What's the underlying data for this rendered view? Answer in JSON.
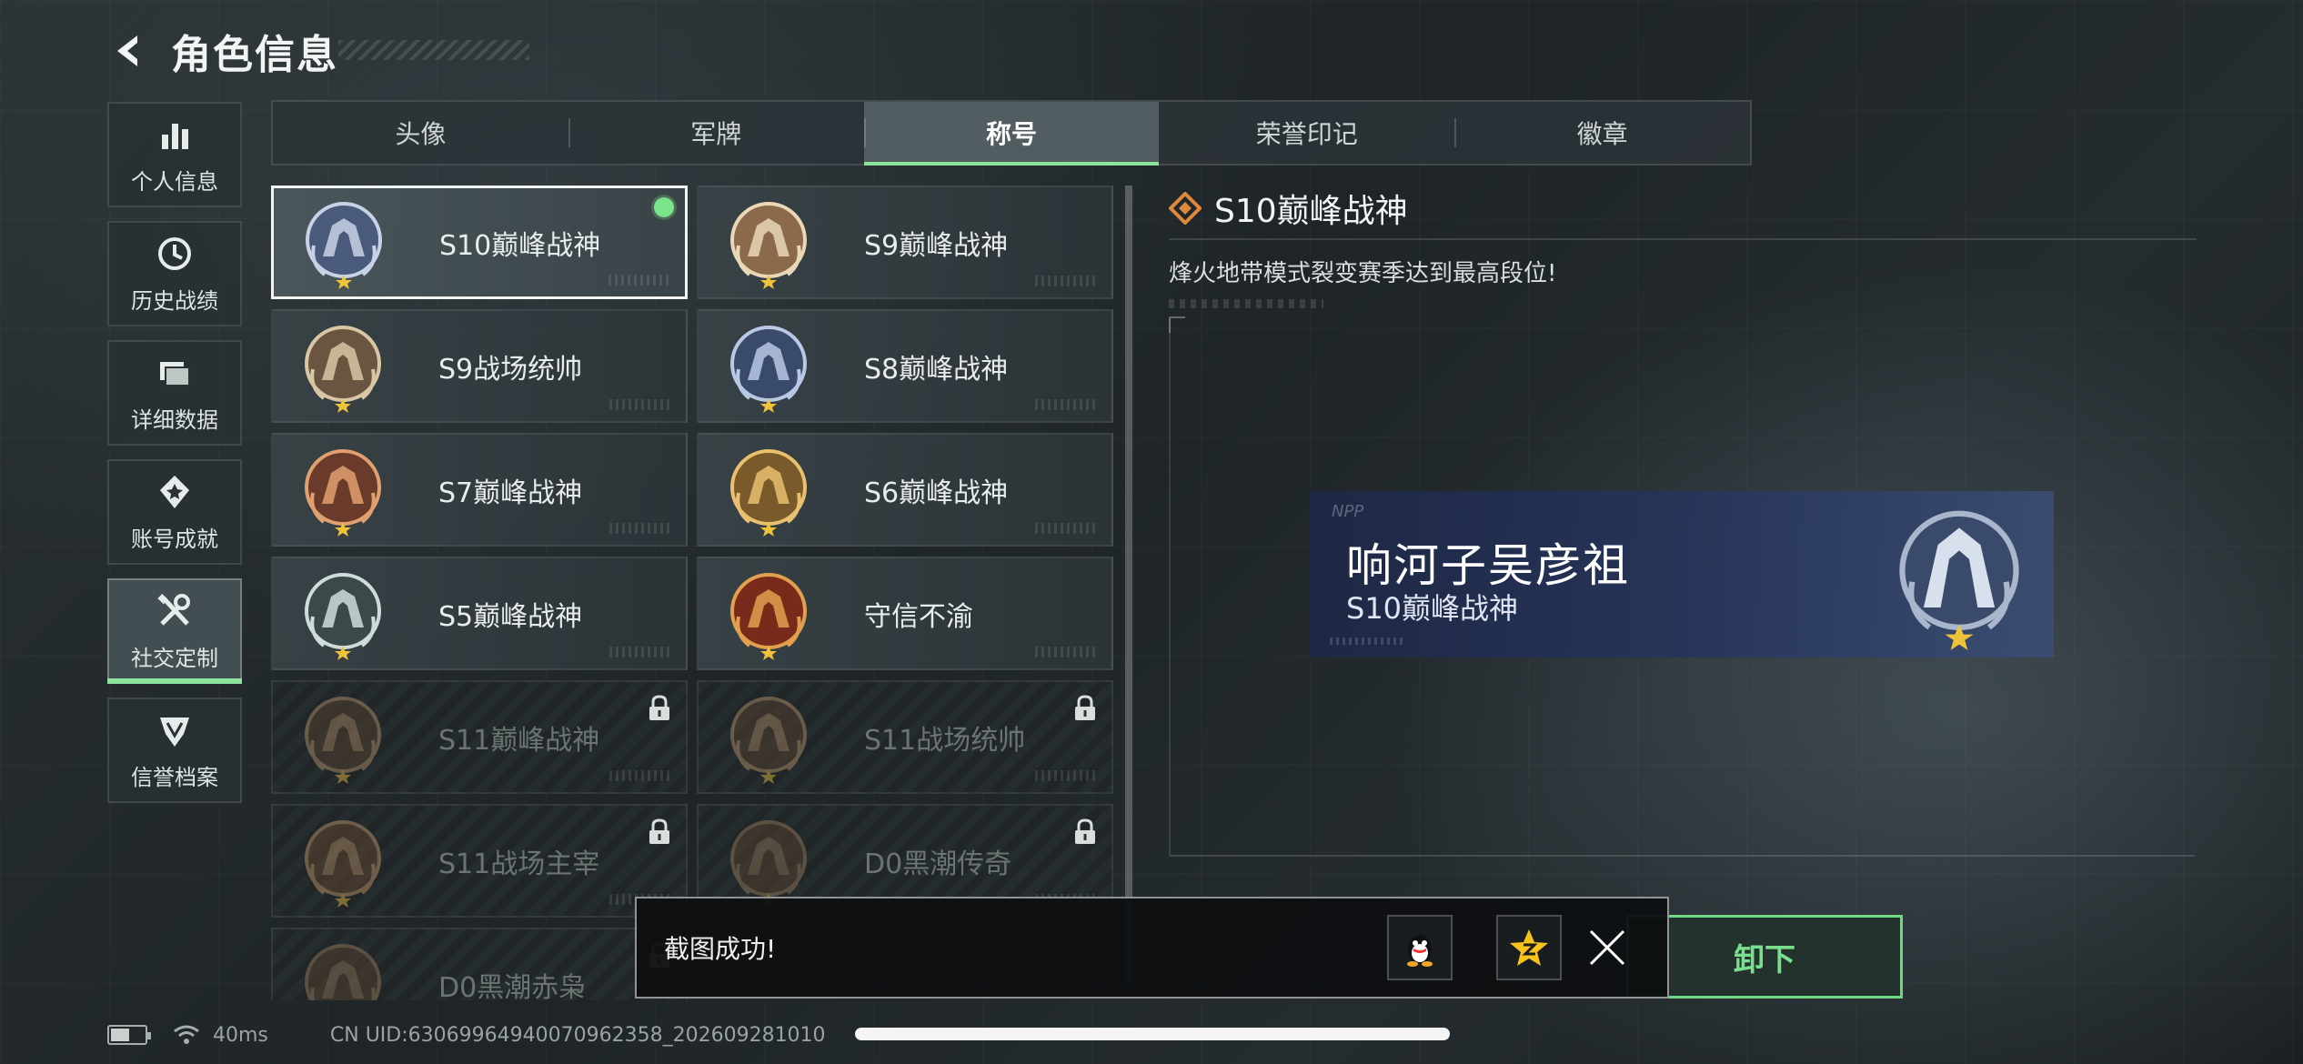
{
  "header": {
    "title": "角色信息"
  },
  "nav": [
    {
      "id": "personal",
      "label": "个人信息",
      "icon": "bar-chart-icon",
      "active": false
    },
    {
      "id": "history",
      "label": "历史战绩",
      "icon": "clock-icon",
      "active": false
    },
    {
      "id": "details",
      "label": "详细数据",
      "icon": "folder-icon",
      "active": false
    },
    {
      "id": "achievements",
      "label": "账号成就",
      "icon": "medal-icon",
      "active": false
    },
    {
      "id": "social",
      "label": "社交定制",
      "icon": "tools-icon",
      "active": true
    },
    {
      "id": "credit",
      "label": "信誉档案",
      "icon": "shield-icon",
      "active": false
    }
  ],
  "tabs": [
    {
      "label": "头像",
      "active": false
    },
    {
      "label": "军牌",
      "active": false
    },
    {
      "label": "称号",
      "active": true
    },
    {
      "label": "荣誉印记",
      "active": false
    },
    {
      "label": "徽章",
      "active": false
    }
  ],
  "titles": [
    {
      "name": "S10巅峰战神",
      "selected": true,
      "equipped": true,
      "locked": false
    },
    {
      "name": "S9巅峰战神",
      "selected": false,
      "equipped": false,
      "locked": false
    },
    {
      "name": "S9战场统帅",
      "selected": false,
      "equipped": false,
      "locked": false
    },
    {
      "name": "S8巅峰战神",
      "selected": false,
      "equipped": false,
      "locked": false
    },
    {
      "name": "S7巅峰战神",
      "selected": false,
      "equipped": false,
      "locked": false
    },
    {
      "name": "S6巅峰战神",
      "selected": false,
      "equipped": false,
      "locked": false
    },
    {
      "name": "S5巅峰战神",
      "selected": false,
      "equipped": false,
      "locked": false
    },
    {
      "name": "守信不渝",
      "selected": false,
      "equipped": false,
      "locked": false
    },
    {
      "name": "S11巅峰战神",
      "selected": false,
      "equipped": false,
      "locked": true
    },
    {
      "name": "S11战场统帅",
      "selected": false,
      "equipped": false,
      "locked": true
    },
    {
      "name": "S11战场主宰",
      "selected": false,
      "equipped": false,
      "locked": true
    },
    {
      "name": "D0黑潮传奇",
      "selected": false,
      "equipped": false,
      "locked": true
    },
    {
      "name": "D0黑潮赤枭",
      "selected": false,
      "equipped": false,
      "locked": true
    }
  ],
  "detail": {
    "title": "S10巅峰战神",
    "description": "烽火地带模式裂变赛季达到最高段位!"
  },
  "preview": {
    "brand": "NPP",
    "player_name": "响河子吴彦祖",
    "title": "S10巅峰战神"
  },
  "unequip_button": {
    "label": "卸下"
  },
  "toast": {
    "message": "截图成功!"
  },
  "status": {
    "ping": "40ms",
    "uid": "CN UID:6306996494007096​2358_202609281010",
    "battery_level": 0.55
  },
  "colors": {
    "accent": "#8be39c",
    "equipped": "#7be38c"
  }
}
